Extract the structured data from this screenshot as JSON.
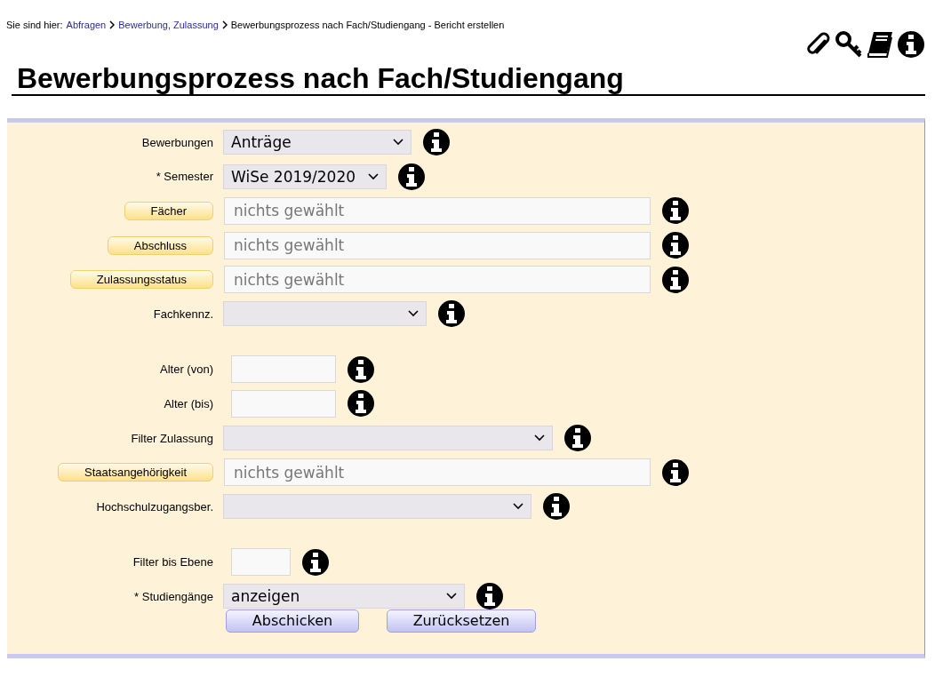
{
  "breadcrumb": {
    "prefix": "Sie sind hier:",
    "links": [
      "Abfragen",
      "Bewerbung, Zulassung"
    ],
    "current": "Bewerbungsprozess nach Fach/Studiengang - Bericht erstellen"
  },
  "title": "Bewerbungsprozess nach Fach/Studiengang",
  "form": {
    "rows": [
      {
        "kind": "select",
        "label": "Bewerbungen",
        "value": "Anträge"
      },
      {
        "kind": "select",
        "label": "* Semester",
        "value": "WiSe 2019/2020"
      },
      {
        "kind": "picker",
        "label": "Fächer",
        "placeholder": "nichts gewählt"
      },
      {
        "kind": "picker",
        "label": "Abschluss",
        "placeholder": "nichts gewählt"
      },
      {
        "kind": "picker",
        "label": "Zulassungsstatus",
        "placeholder": "nichts gewählt"
      },
      {
        "kind": "select",
        "label": "Fachkennz."
      },
      {
        "kind": "spacer"
      },
      {
        "kind": "text",
        "label": "Alter (von)"
      },
      {
        "kind": "text",
        "label": "Alter (bis)"
      },
      {
        "kind": "select",
        "label": "Filter Zulassung"
      },
      {
        "kind": "picker",
        "label": "Staatsangehörigkeit",
        "placeholder": "nichts gewählt"
      },
      {
        "kind": "select",
        "label": "Hochschulzugangsber."
      },
      {
        "kind": "spacer"
      },
      {
        "kind": "text",
        "label": "Filter bis Ebene"
      },
      {
        "kind": "select",
        "label": "* Studiengänge",
        "value": "anzeigen"
      }
    ],
    "buttons": [
      "Abschicken",
      "Zurücksetzen"
    ]
  }
}
